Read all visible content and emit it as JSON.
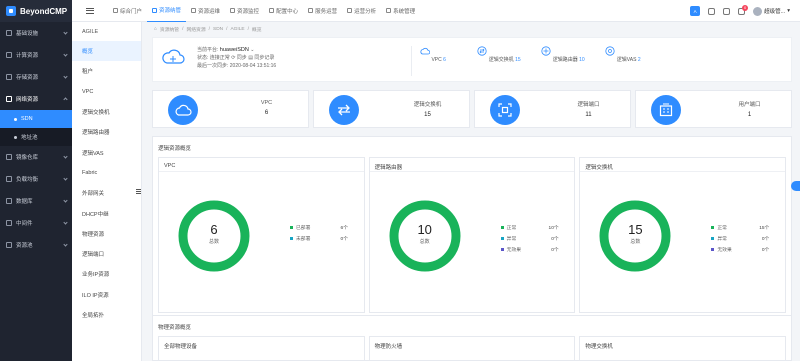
{
  "brand": "BeyondCMP",
  "sidebar": {
    "items": [
      {
        "label": "基础设施"
      },
      {
        "label": "计算资源"
      },
      {
        "label": "存储资源"
      },
      {
        "label": "网络资源"
      },
      {
        "label": "镜像仓库"
      },
      {
        "label": "负载均衡"
      },
      {
        "label": "数据库"
      },
      {
        "label": "中间件"
      },
      {
        "label": "资源池"
      }
    ],
    "sub_items": [
      {
        "label": "SDN"
      },
      {
        "label": "地址池"
      }
    ]
  },
  "topnav": {
    "tabs": [
      {
        "label": "综合门户"
      },
      {
        "label": "资源纳管"
      },
      {
        "label": "资源运维"
      },
      {
        "label": "资源监控"
      },
      {
        "label": "配置中心"
      },
      {
        "label": "服务运营"
      },
      {
        "label": "运营分析"
      },
      {
        "label": "系统管理"
      }
    ],
    "lang": "A",
    "notification_count": "0",
    "username": "超级管..."
  },
  "submenu": {
    "header": "AGILE",
    "items": [
      {
        "label": "概览"
      },
      {
        "label": "租户"
      },
      {
        "label": "VPC"
      },
      {
        "label": "逻辑交换机"
      },
      {
        "label": "逻辑路由器"
      },
      {
        "label": "逻辑VAS"
      },
      {
        "label": "Fabric"
      },
      {
        "label": "外部网关"
      },
      {
        "label": "DHCP中继"
      },
      {
        "label": "物理资源"
      },
      {
        "label": "逻辑端口"
      },
      {
        "label": "业务IP资源"
      },
      {
        "label": "ILO IP资源"
      },
      {
        "label": "全局拓扑"
      }
    ]
  },
  "breadcrumb": [
    "资源纳管",
    "网络资源",
    "SDN",
    "AGILE",
    "概览"
  ],
  "platform": {
    "current_label": "当前平台:",
    "current_value": "huaweiSDN",
    "status_label": "状态:",
    "status_value": "连接正常",
    "sync_label": "同步",
    "sync_record_label": "同步记录",
    "last_sync_label": "最后一次同步:",
    "last_sync_value": "2020-08-04 13:51:16"
  },
  "platform_stats": [
    {
      "label": "VPC",
      "value": "6"
    },
    {
      "label": "逻辑交换机",
      "value": "15"
    },
    {
      "label": "逻辑路由器",
      "value": "10"
    },
    {
      "label": "逻辑VAS",
      "value": "2"
    }
  ],
  "summary_cards": [
    {
      "label": "VPC",
      "value": "6"
    },
    {
      "label": "逻辑交换机",
      "value": "15"
    },
    {
      "label": "逻辑端口",
      "value": "11"
    },
    {
      "label": "用户端口",
      "value": "1"
    }
  ],
  "logical_section": {
    "title": "逻辑资源概览",
    "charts": [
      {
        "title": "VPC",
        "total": "6",
        "total_label": "总数",
        "legend": [
          {
            "label": "已部署",
            "value": "6个",
            "color": "#19b35a"
          },
          {
            "label": "未部署",
            "value": "0个",
            "color": "#17a5c4"
          }
        ]
      },
      {
        "title": "逻辑路由器",
        "total": "10",
        "total_label": "总数",
        "legend": [
          {
            "label": "正常",
            "value": "10个",
            "color": "#19b35a"
          },
          {
            "label": "异常",
            "value": "0个",
            "color": "#17a5c4"
          },
          {
            "label": "无效果",
            "value": "0个",
            "color": "#5b55c9"
          }
        ]
      },
      {
        "title": "逻辑交换机",
        "total": "15",
        "total_label": "总数",
        "legend": [
          {
            "label": "正常",
            "value": "15个",
            "color": "#19b35a"
          },
          {
            "label": "异常",
            "value": "0个",
            "color": "#17a5c4"
          },
          {
            "label": "无效果",
            "value": "0个",
            "color": "#5b55c9"
          }
        ]
      }
    ]
  },
  "physical_section": {
    "title": "物理资源概览",
    "charts": [
      {
        "title": "全部物理设备"
      },
      {
        "title": "物理防火墙"
      },
      {
        "title": "物理交换机"
      }
    ]
  },
  "colors": {
    "accent": "#2f8cff",
    "sidebar_bg": "#1f2430",
    "donut_green": "#19b35a"
  }
}
